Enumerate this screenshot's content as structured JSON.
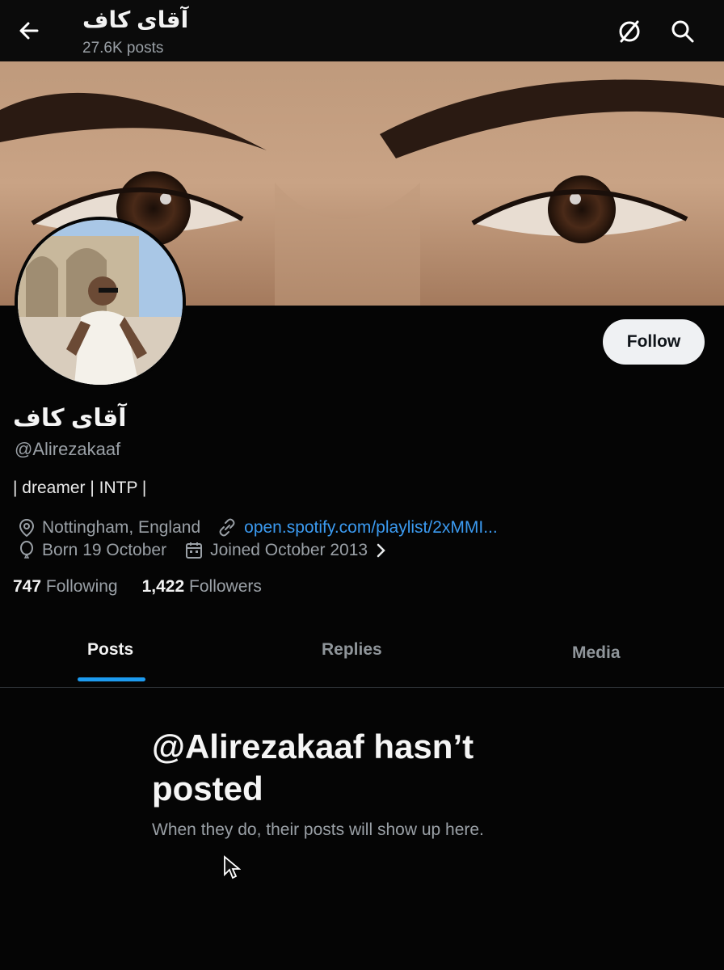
{
  "header": {
    "back_icon": "arrow-left-icon",
    "title": "آقای کاف",
    "post_count": "27.6K posts",
    "hide_icon": "no-eye-icon",
    "search_icon": "search-icon"
  },
  "profile": {
    "follow_label": "Follow",
    "display_name": "آقای کاف",
    "handle": "@Alirezakaaf",
    "bio": "| dreamer | INTP |",
    "location": "Nottingham, England",
    "link": "open.spotify.com/playlist/2xMMI...",
    "birthday": "Born 19 October",
    "joined": "Joined October 2013",
    "following_count": "747",
    "following_label": "Following",
    "followers_count": "1,422",
    "followers_label": "Followers"
  },
  "tabs": [
    {
      "label": "Posts",
      "active": true
    },
    {
      "label": "Replies",
      "active": false
    },
    {
      "label": "Media",
      "active": false
    }
  ],
  "empty_state": {
    "title": "@Alirezakaaf hasn’t posted",
    "subtitle": "When they do, their posts will show up here."
  },
  "colors": {
    "accent": "#1d9bf0",
    "link": "#3b9af0",
    "background": "#050505",
    "muted_text": "#9aa0a6"
  }
}
